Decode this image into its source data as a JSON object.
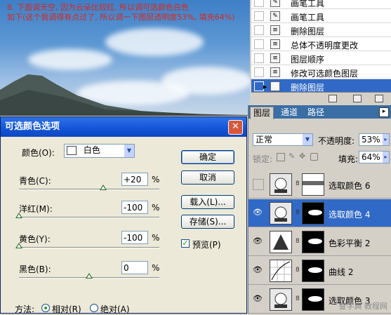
{
  "caption": {
    "line1": "8. 下面调天空, 因为云朵比较红, 所以调可选颜色白色",
    "line2": "如下(这个我调得有点过了, 所以调一下图层透明度53%, 填充64%)"
  },
  "history": {
    "items": [
      {
        "label": "画笔工具",
        "icon": "brush-icon"
      },
      {
        "label": "画笔工具",
        "icon": "brush-icon"
      },
      {
        "label": "删除图层",
        "icon": "history-state-icon"
      },
      {
        "label": "总体不透明度更改",
        "icon": "history-state-icon"
      },
      {
        "label": "图层顺序",
        "icon": "history-state-icon"
      },
      {
        "label": "修改可选颜色图层",
        "icon": "history-state-icon"
      },
      {
        "label": "删除图层",
        "icon": "history-state-icon",
        "active": true
      }
    ]
  },
  "dialog": {
    "title": "可选颜色选项",
    "color_label": "颜色(O):",
    "color_value": "白色",
    "sliders": [
      {
        "label": "青色(C):",
        "value": "+20",
        "level": 20
      },
      {
        "label": "洋红(M):",
        "value": "-100",
        "level": -100
      },
      {
        "label": "黄色(Y):",
        "value": "-100",
        "level": -100
      },
      {
        "label": "黑色(B):",
        "value": "0",
        "level": 0
      }
    ],
    "percent": "%",
    "buttons": {
      "ok": "确定",
      "cancel": "取消",
      "load": "载入(L)...",
      "save": "存储(S)..."
    },
    "preview_label": "预览(P)",
    "preview_checked": true,
    "method_label": "方法:",
    "method_relative": "相对(R)",
    "method_absolute": "绝对(A)",
    "method_selected": "relative"
  },
  "layers": {
    "tabs": [
      "图层",
      "通道",
      "路径"
    ],
    "active_tab": "图层",
    "blend_mode": "正常",
    "opacity_label": "不透明度:",
    "opacity_value": "53%",
    "lock_label": "锁定:",
    "fill_label": "填充:",
    "fill_value": "64%",
    "items": [
      {
        "name": "选取颜色 6",
        "visible": false,
        "selected": false,
        "icon": "selective-color-icon"
      },
      {
        "name": "选取颜色 4",
        "visible": true,
        "selected": true,
        "icon": "selective-color-icon"
      },
      {
        "name": "色彩平衡 2",
        "visible": true,
        "selected": false,
        "icon": "color-balance-icon"
      },
      {
        "name": "曲线 2",
        "visible": true,
        "selected": false,
        "icon": "curves-icon"
      },
      {
        "name": "选取颜色 3",
        "visible": true,
        "selected": false,
        "icon": "selective-color-icon"
      }
    ]
  },
  "watermark": "查字典 教程网",
  "colors": {
    "caption": "#d8281c",
    "selection": "#3169c6",
    "titlebar": "#1254d6"
  }
}
